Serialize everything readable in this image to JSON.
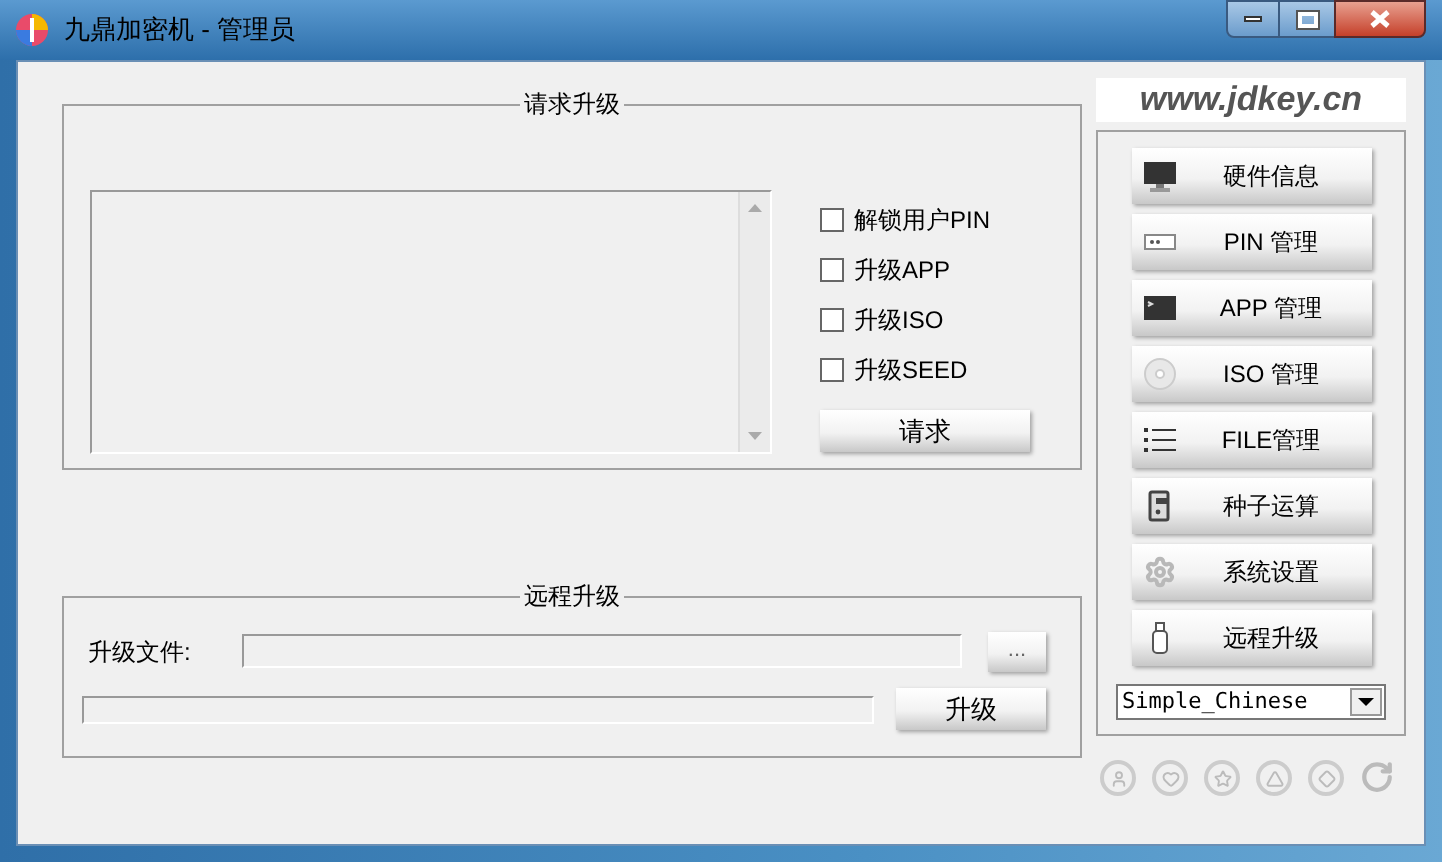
{
  "window": {
    "title": "九鼎加密机 - 管理员"
  },
  "request_panel": {
    "title": "请求升级",
    "options": [
      {
        "label": "解锁用户PIN",
        "checked": false
      },
      {
        "label": "升级APP",
        "checked": false
      },
      {
        "label": "升级ISO",
        "checked": false
      },
      {
        "label": "升级SEED",
        "checked": false
      }
    ],
    "button": "请求"
  },
  "remote_panel": {
    "title": "远程升级",
    "file_label": "升级文件:",
    "browse_button": "...",
    "progress": {
      "level": 0
    },
    "button": "升级"
  },
  "brand": "www.jdkey.cn",
  "menu": [
    {
      "kind": "monitor",
      "label": "硬件信息"
    },
    {
      "kind": "pin",
      "label": "PIN 管理"
    },
    {
      "kind": "terminal",
      "label": "APP 管理"
    },
    {
      "kind": "disc",
      "label": "ISO 管理"
    },
    {
      "kind": "list",
      "label": "FILE管理"
    },
    {
      "kind": "key",
      "label": "种子运算"
    },
    {
      "kind": "gear",
      "label": "系统设置"
    },
    {
      "kind": "usb",
      "label": "远程升级"
    }
  ],
  "language": {
    "value": "Simple_Chinese"
  }
}
